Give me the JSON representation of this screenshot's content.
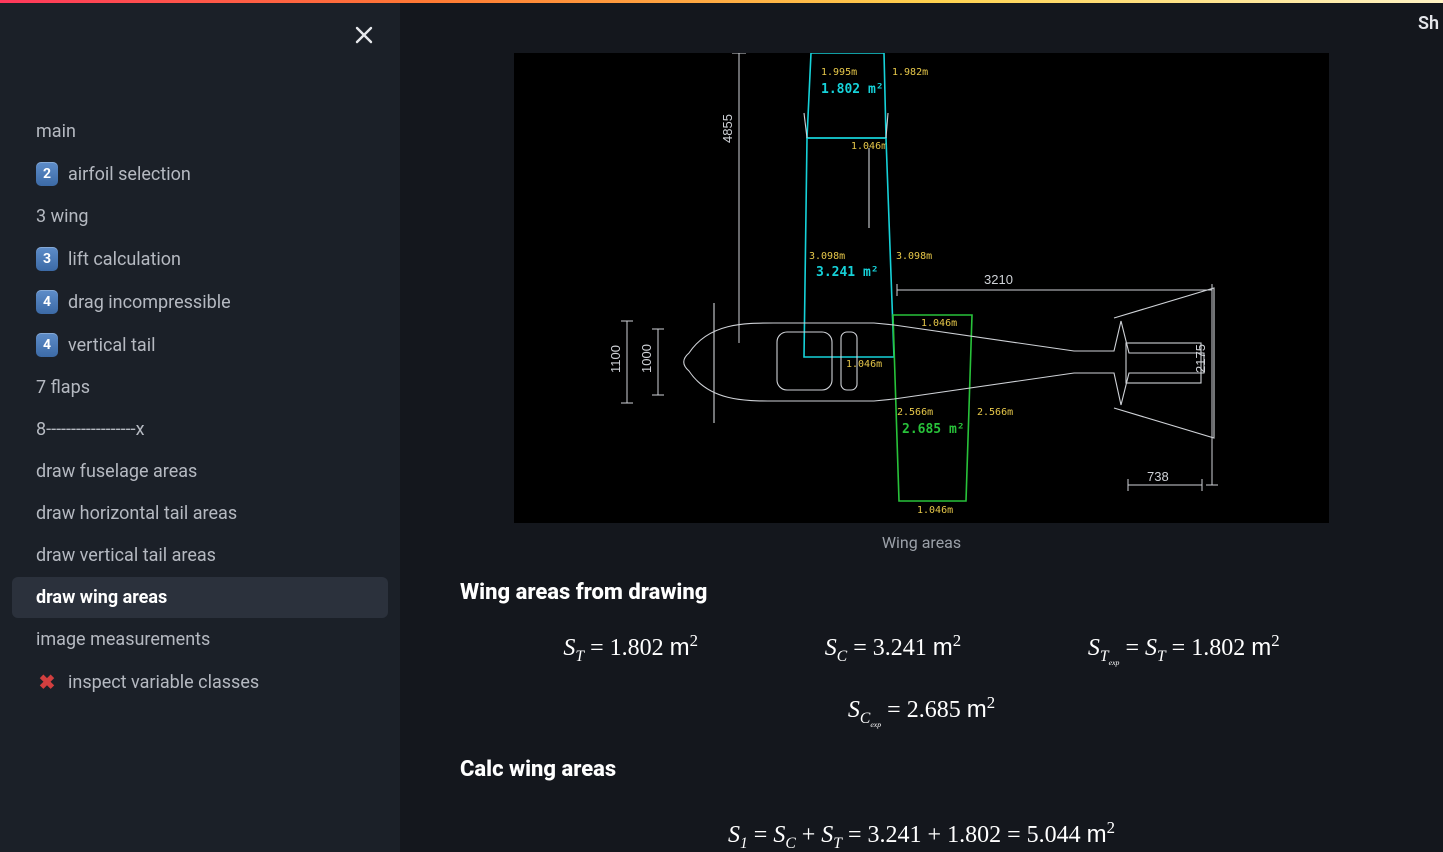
{
  "top_corner_text": "Sh",
  "sidebar": {
    "items": [
      {
        "icon": null,
        "label": "main"
      },
      {
        "icon": "key-2",
        "label": "airfoil selection"
      },
      {
        "icon": null,
        "label": "3 wing"
      },
      {
        "icon": "key-3",
        "label": "lift calculation"
      },
      {
        "icon": "key-4",
        "label": "drag incompressible"
      },
      {
        "icon": "key-4",
        "label": "vertical tail"
      },
      {
        "icon": null,
        "label": "7 flaps"
      },
      {
        "icon": null,
        "label": "8------------------x"
      },
      {
        "icon": null,
        "label": "draw fuselage areas"
      },
      {
        "icon": null,
        "label": "draw horizontal tail areas"
      },
      {
        "icon": null,
        "label": "draw vertical tail areas"
      },
      {
        "icon": null,
        "label": "draw wing areas",
        "active": true
      },
      {
        "icon": null,
        "label": "image measurements"
      },
      {
        "icon": "x",
        "label": "inspect variable classes"
      }
    ]
  },
  "figure": {
    "caption": "Wing areas",
    "dimensions_mm": {
      "span_half": "4855",
      "fuselage_h1": "1100",
      "fuselage_h2": "1000",
      "tail_span": "3210",
      "tail_height": "2175",
      "tail_root": "738"
    },
    "cyan_box_top": {
      "w1": "1.995m",
      "w2": "1.982m",
      "area": "1.802",
      "unit": "m²"
    },
    "cyan_box_mid": {
      "w1": "3.098m",
      "w2": "3.098m",
      "area": "3.241",
      "unit": "m²",
      "side": "1.046m"
    },
    "green_box": {
      "w1": "2.566m",
      "w2": "2.566m",
      "area": "2.685",
      "unit": "m²",
      "top": "1.046m",
      "bottom": "1.046m"
    },
    "fuse_inside": {
      "label": "1.046m"
    }
  },
  "headings": {
    "from_drawing": "Wing areas from drawing",
    "calc": "Calc wing areas"
  },
  "equations": {
    "ST": {
      "value": "1.802",
      "unit": "m"
    },
    "SC": {
      "value": "3.241",
      "unit": "m"
    },
    "STexp": {
      "value": "1.802",
      "unit": "m"
    },
    "SCexp": {
      "value": "2.685",
      "unit": "m"
    },
    "S1": {
      "a": "3.241",
      "b": "1.802",
      "sum": "5.044",
      "unit": "m"
    }
  }
}
